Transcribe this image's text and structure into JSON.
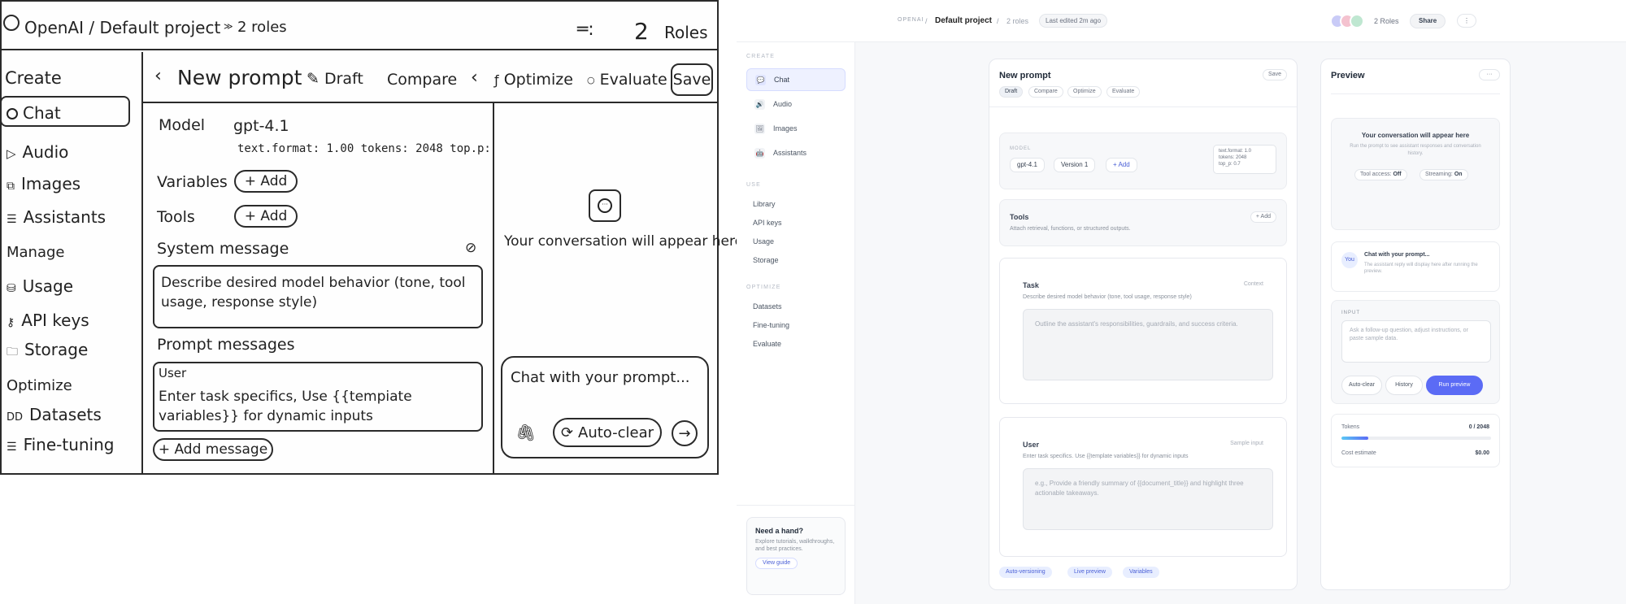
{
  "sketch": {
    "breadcrumb": "OpenAI / Default project",
    "roles_count": "2 roles",
    "roles_num": "2",
    "roles_label": "Roles",
    "sidebar": {
      "create_title": "Create",
      "create_items": [
        {
          "label": "Chat",
          "icon": "chat-icon"
        },
        {
          "label": "Audio",
          "icon": "play-icon"
        },
        {
          "label": "Images",
          "icon": "image-icon"
        },
        {
          "label": "Assistants",
          "icon": "list-icon"
        }
      ],
      "manage_title": "Manage",
      "manage_items": [
        {
          "label": "Usage",
          "icon": "database-icon"
        },
        {
          "label": "API keys",
          "icon": "key-icon"
        },
        {
          "label": "Storage",
          "icon": "folder-icon"
        }
      ],
      "optimize_title": "Optimize",
      "optimize_items": [
        {
          "label": "Datasets",
          "icon": "datasets-icon"
        },
        {
          "label": "Fine-tuning",
          "icon": "list-icon"
        }
      ]
    },
    "toolbar": {
      "title": "New prompt",
      "draft": "Draft",
      "compare": "Compare",
      "optimize": "Optimize",
      "evaluate": "Evaluate",
      "save": "Save"
    },
    "model_label": "Model",
    "model_value": "gpt-4.1",
    "model_params": "text.format: 1.00 tokens: 2048 top.p:",
    "variables_label": "Variables",
    "tools_label": "Tools",
    "add_label": "+ Add",
    "system_label": "System message",
    "system_placeholder": "Describe desired model behavior (tone, tool usage, response style)",
    "prompt_messages_label": "Prompt messages",
    "user_label": "User",
    "user_placeholder": "Enter task specifics, Use {{tempiate variables}} for dynamic inputs",
    "add_message": "+ Add message",
    "conversation_empty": "Your conversation will appear here",
    "chat_placeholder": "Chat with your prompt...",
    "auto_clear": "Auto-clear"
  },
  "ui": {
    "topbar": {
      "org": "OPENAI",
      "sep": "/",
      "project": "Default project",
      "roles": "2 roles",
      "last_edited": "Last edited 2m ago",
      "roles_right": "2 Roles",
      "share": "Share",
      "more": "⋮"
    },
    "sidebar": {
      "create_title": "CREATE",
      "create_items": [
        {
          "label": "Chat",
          "icon": "💬"
        },
        {
          "label": "Audio",
          "icon": "🔊"
        },
        {
          "label": "Images",
          "icon": "🖼"
        },
        {
          "label": "Assistants",
          "icon": "🤖"
        }
      ],
      "use_title": "USE",
      "use_items": [
        "Library",
        "API keys",
        "Usage",
        "Storage"
      ],
      "optimize_title": "OPTIMIZE",
      "optimize_items": [
        "Datasets",
        "Fine-tuning",
        "Evaluate"
      ],
      "help_title": "Need a hand?",
      "help_text": "Explore tutorials, walkthroughs, and best practices.",
      "help_button": "View guide"
    },
    "editor": {
      "title": "New prompt",
      "save": "Save",
      "tabs": [
        "Draft",
        "Compare",
        "Optimize",
        "Evaluate"
      ],
      "model_label": "MODEL",
      "model": "gpt-4.1",
      "version": "Version 1",
      "add": "+ Add",
      "params": [
        "text.format: 1.0",
        "tokens: 2048",
        "top_p: 0.7"
      ],
      "tools_title": "Tools",
      "tools_desc": "Attach retrieval, functions, or structured outputs.",
      "tools_add": "+ Add",
      "task_title": "Task",
      "task_tag": "Context",
      "task_desc": "Describe desired model behavior (tone, tool usage, response style)",
      "task_placeholder": "Outline the assistant's responsibilities, guardrails, and success criteria.",
      "user_title": "User",
      "user_tag": "Sample input",
      "user_desc": "Enter task specifics. Use {{template variables}} for dynamic inputs",
      "user_placeholder": "e.g., Provide a friendly summary of {{document_title}} and highlight three actionable takeaways.",
      "footer_tags": [
        "Auto-versioning",
        "Live preview",
        "Variables"
      ]
    },
    "preview": {
      "title": "Preview",
      "more": "···",
      "empty_title": "Your conversation will appear here",
      "empty_desc": "Run the prompt to see assistant responses and conversation history.",
      "tool_access_label": "Tool access:",
      "tool_access_value": "Off",
      "streaming_label": "Streaming:",
      "streaming_value": "On",
      "avatar": "You",
      "chat_title": "Chat with your prompt...",
      "chat_desc": "The assistant reply will display here after running the preview.",
      "input_label": "INPUT",
      "input_placeholder": "Ask a follow-up question, adjust instructions, or paste sample data.",
      "auto_clear": "Auto-clear",
      "history": "History",
      "run": "Run preview",
      "tokens_label": "Tokens",
      "tokens_value": "0 / 2048",
      "tokens_fill_fraction": 0.18,
      "cost_label": "Cost estimate",
      "cost_value": "$0.00",
      "accent": "#5b6bf5"
    }
  }
}
